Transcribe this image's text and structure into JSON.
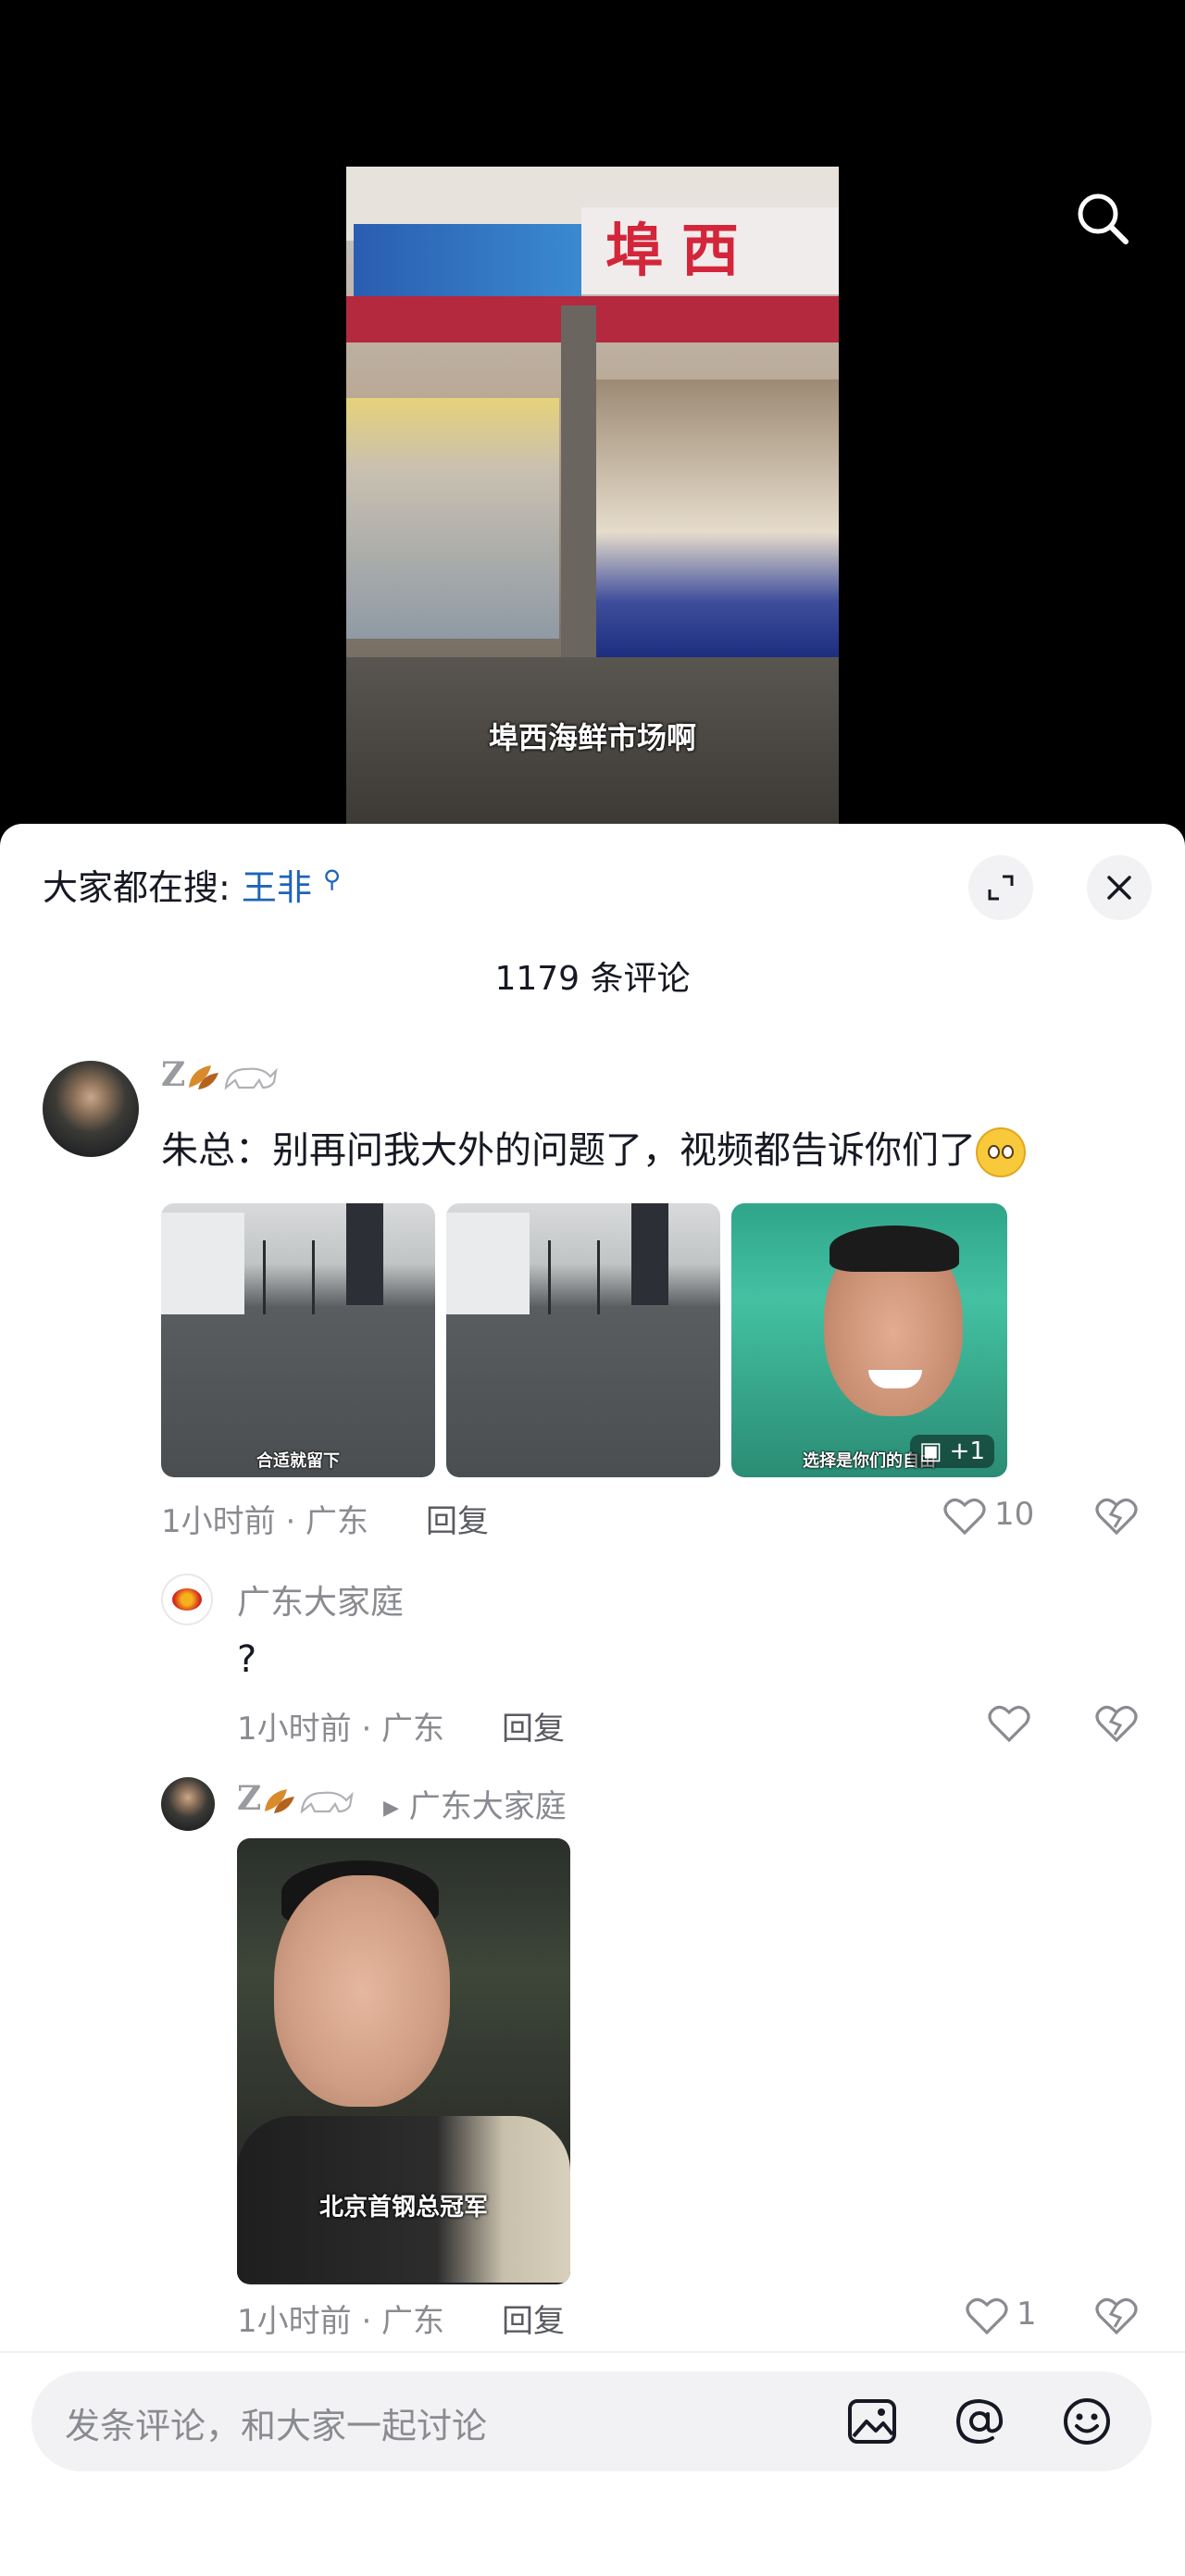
{
  "video": {
    "caption": "埠西海鲜市场啊",
    "sign_text": "埠西"
  },
  "panel": {
    "hot_search_prefix": "大家都在搜:",
    "hot_search_keyword": "王非",
    "comment_count": "1179 条评论"
  },
  "comments": [
    {
      "user": "Z",
      "text": "朱总：别再问我大外的问题了，视频都告诉你们了",
      "images": [
        {
          "caption": "合适就留下"
        },
        {
          "caption": ""
        },
        {
          "caption": "选择是你们的自由",
          "more": "+1"
        }
      ],
      "meta": "1小时前 · 广东",
      "reply_label": "回复",
      "likes": "10"
    }
  ],
  "replies": [
    {
      "user": "广东大家庭",
      "text": "?",
      "meta": "1小时前 · 广东",
      "reply_label": "回复",
      "likes": ""
    },
    {
      "user": "Z",
      "reply_to": "广东大家庭",
      "video_caption": "北京首钢总冠军",
      "meta": "1小时前 · 广东",
      "reply_label": "回复",
      "likes": "1"
    }
  ],
  "input": {
    "placeholder": "发条评论，和大家一起讨论"
  },
  "colors": {
    "accent_blue": "#1e64b8",
    "text": "#161823",
    "muted": "#8a8b91"
  }
}
